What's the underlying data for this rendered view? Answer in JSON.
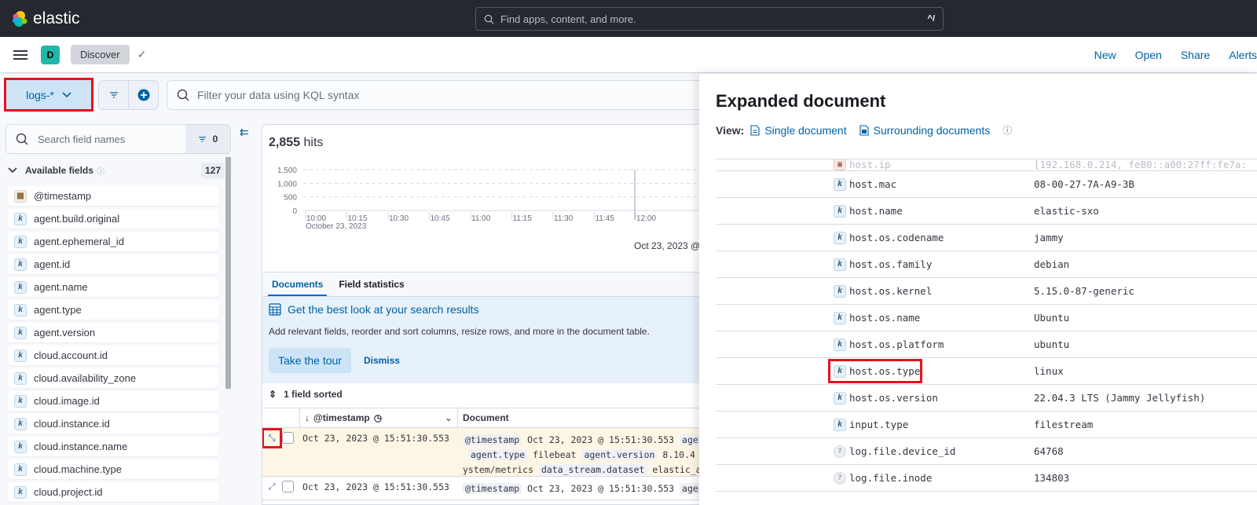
{
  "topbar": {
    "brand": "elastic",
    "search_placeholder": "Find apps, content, and more.",
    "search_shortcut": "^/"
  },
  "appbar": {
    "space_initial": "D",
    "breadcrumb": "Discover",
    "links": [
      "New",
      "Open",
      "Share",
      "Alerts"
    ]
  },
  "querybar": {
    "dataview": "logs-*",
    "kql_placeholder": "Filter your data using KQL syntax"
  },
  "sidebar": {
    "search_placeholder": "Search field names",
    "filter_count": "0",
    "available_label": "Available fields",
    "available_count": "127",
    "fields": [
      {
        "name": "@timestamp",
        "type": "date"
      },
      {
        "name": "agent.build.original",
        "type": "keyword"
      },
      {
        "name": "agent.ephemeral_id",
        "type": "keyword"
      },
      {
        "name": "agent.id",
        "type": "keyword"
      },
      {
        "name": "agent.name",
        "type": "keyword"
      },
      {
        "name": "agent.type",
        "type": "keyword"
      },
      {
        "name": "agent.version",
        "type": "keyword"
      },
      {
        "name": "cloud.account.id",
        "type": "keyword"
      },
      {
        "name": "cloud.availability_zone",
        "type": "keyword"
      },
      {
        "name": "cloud.image.id",
        "type": "keyword"
      },
      {
        "name": "cloud.instance.id",
        "type": "keyword"
      },
      {
        "name": "cloud.instance.name",
        "type": "keyword"
      },
      {
        "name": "cloud.machine.type",
        "type": "keyword"
      },
      {
        "name": "cloud.project.id",
        "type": "keyword"
      }
    ]
  },
  "main": {
    "hits_count": "2,855",
    "hits_label": "hits",
    "chart_footer": "Oct 23, 2023 @",
    "tabs": [
      "Documents",
      "Field statistics"
    ],
    "callout": {
      "title": "Get the best look at your search results",
      "body": "Add relevant fields, reorder and sort columns, resize rows, and more in the document table.",
      "tour": "Take the tour",
      "dismiss": "Dismiss"
    },
    "sorted_label": "1 field sorted",
    "columns": [
      "@timestamp",
      "Document"
    ],
    "rows": [
      {
        "timestamp": "Oct 23, 2023 @ 15:51:30.553",
        "doc_lines": [
          [
            {
              "k": "@timestamp"
            },
            {
              "v": " Oct 23, 2023 @ 15:51:30.553 "
            },
            {
              "k": "age"
            }
          ],
          [
            {
              "v": " "
            },
            {
              "k": "agent.type"
            },
            {
              "v": " filebeat "
            },
            {
              "k": "agent.version"
            },
            {
              "v": " 8.10.4"
            }
          ],
          [
            {
              "v": "ystem/metrics "
            },
            {
              "k": "data_stream.dataset"
            },
            {
              "v": " elastic_a"
            }
          ]
        ]
      },
      {
        "timestamp": "Oct 23, 2023 @ 15:51:30.553",
        "doc_lines": [
          [
            {
              "k": "@timestamp"
            },
            {
              "v": " Oct 23, 2023 @ 15:51:30.553 "
            },
            {
              "k": "age"
            }
          ]
        ]
      }
    ]
  },
  "chart_data": {
    "type": "bar",
    "title": "",
    "xlabel": "",
    "ylabel": "",
    "yticks": [
      "0",
      "500",
      "1,000",
      "1,500"
    ],
    "ylim": [
      0,
      1500
    ],
    "xticks": [
      "10:00",
      "10:15",
      "10:30",
      "10:45",
      "11:00",
      "11:15",
      "11:30",
      "11:45",
      "12:00"
    ],
    "x_sublabel": "October 23, 2023",
    "values": [
      0,
      0,
      0,
      0,
      0,
      0,
      0,
      0,
      0
    ],
    "grid": true
  },
  "flyout": {
    "title": "Expanded document",
    "view_label": "View:",
    "single_doc": "Single document",
    "surrounding_docs": "Surrounding documents",
    "fields": [
      {
        "name": "host.ip",
        "value": "[192.168.0.214, fe80::a00:27ff:fe7a:",
        "type": "ip",
        "partial": true
      },
      {
        "name": "host.mac",
        "value": "08-00-27-7A-A9-3B",
        "type": "keyword"
      },
      {
        "name": "host.name",
        "value": "elastic-sxo",
        "type": "keyword"
      },
      {
        "name": "host.os.codename",
        "value": "jammy",
        "type": "keyword"
      },
      {
        "name": "host.os.family",
        "value": "debian",
        "type": "keyword"
      },
      {
        "name": "host.os.kernel",
        "value": "5.15.0-87-generic",
        "type": "keyword"
      },
      {
        "name": "host.os.name",
        "value": "Ubuntu",
        "type": "keyword"
      },
      {
        "name": "host.os.platform",
        "value": "ubuntu",
        "type": "keyword"
      },
      {
        "name": "host.os.type",
        "value": "linux",
        "type": "keyword",
        "highlight": true
      },
      {
        "name": "host.os.version",
        "value": "22.04.3 LTS (Jammy Jellyfish)",
        "type": "keyword"
      },
      {
        "name": "input.type",
        "value": "filestream",
        "type": "keyword"
      },
      {
        "name": "log.file.device_id",
        "value": "64768",
        "type": "unknown"
      },
      {
        "name": "log.file.inode",
        "value": "134803",
        "type": "unknown"
      }
    ]
  },
  "colors": {
    "accent": "#0061a6",
    "highlight": "#e3131d",
    "topbar": "#25282f"
  }
}
